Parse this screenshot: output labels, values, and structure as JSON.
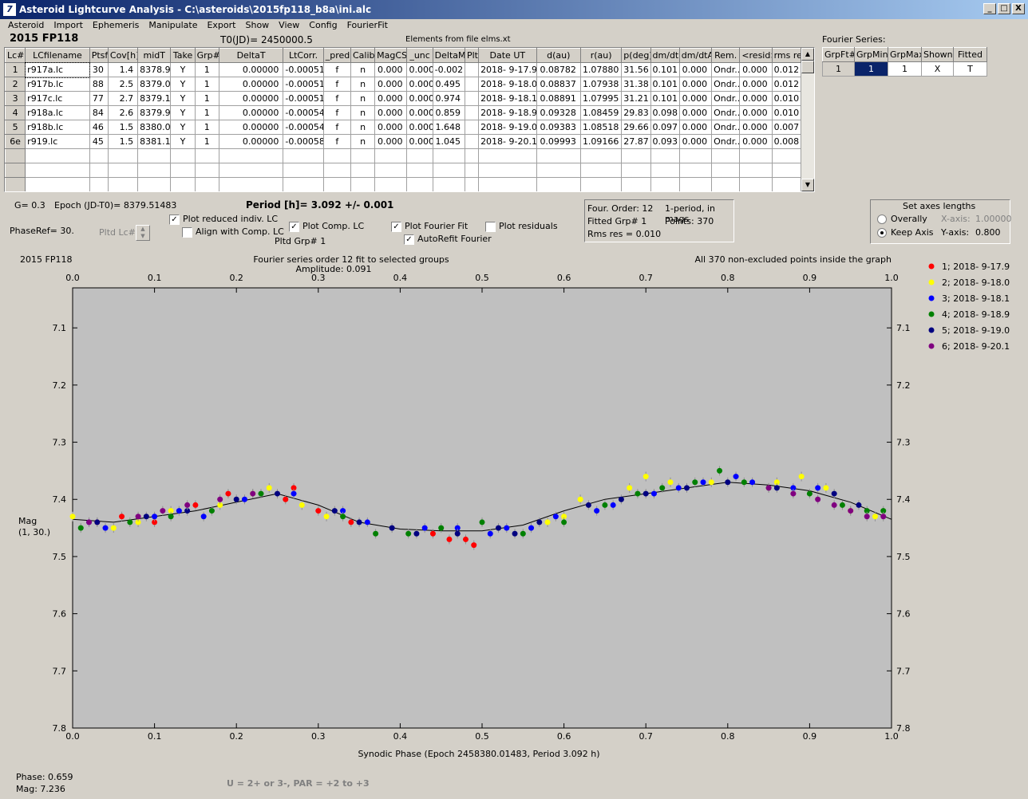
{
  "window": {
    "title": "Asteroid Lightcurve Analysis - C:\\asteroids\\2015fp118_b8a\\ini.alc",
    "icon": "app-icon",
    "minimize": "_",
    "maximize": "□",
    "close": "X"
  },
  "menu": [
    "Asteroid",
    "Import",
    "Ephemeris",
    "Manipulate",
    "Export",
    "Show",
    "View",
    "Config",
    "FourierFit"
  ],
  "header": {
    "asteroid": "2015 FP118",
    "t0": "T0(JD)= 2450000.5",
    "elements": "Elements from file elms.xt"
  },
  "table": {
    "columns": [
      "Lc#",
      "LCfilename",
      "Ptsf",
      "Cov[h]",
      "midT",
      "Take",
      "Grp#",
      "DeltaT",
      "LtCorr.",
      "_pred.",
      "Calib.",
      "MagCS",
      "_unc",
      "DeltaM",
      "Plt",
      "Date UT",
      "d(au)",
      "r(au)",
      "p(deg)",
      "dm/dt",
      "dm/dtA",
      "Rem.",
      "<resid>",
      "rms res"
    ],
    "rows": [
      [
        "1",
        "r917a.lc",
        "30",
        "1.4",
        "8378.9",
        "Y",
        "1",
        "0.00000",
        "-0.00051",
        "f",
        "n",
        "0.000",
        "0.000",
        "-0.002",
        "",
        "2018- 9-17.9",
        "0.08782",
        "1.07880",
        "31.56",
        "0.101",
        "0.000",
        "Ondr...",
        "0.000",
        "0.012"
      ],
      [
        "2",
        "r917b.lc",
        "88",
        "2.5",
        "8379.0",
        "Y",
        "1",
        "0.00000",
        "-0.00051",
        "f",
        "n",
        "0.000",
        "0.000",
        "0.495",
        "",
        "2018- 9-18.0",
        "0.08837",
        "1.07938",
        "31.38",
        "0.101",
        "0.000",
        "Ondr...",
        "0.000",
        "0.012"
      ],
      [
        "3",
        "r917c.lc",
        "77",
        "2.7",
        "8379.1",
        "Y",
        "1",
        "0.00000",
        "-0.00051",
        "f",
        "n",
        "0.000",
        "0.000",
        "0.974",
        "",
        "2018- 9-18.1",
        "0.08891",
        "1.07995",
        "31.21",
        "0.101",
        "0.000",
        "Ondr...",
        "0.000",
        "0.010"
      ],
      [
        "4",
        "r918a.lc",
        "84",
        "2.6",
        "8379.9",
        "Y",
        "1",
        "0.00000",
        "-0.00054",
        "f",
        "n",
        "0.000",
        "0.000",
        "0.859",
        "",
        "2018- 9-18.9",
        "0.09328",
        "1.08459",
        "29.83",
        "0.098",
        "0.000",
        "Ondr...",
        "0.000",
        "0.010"
      ],
      [
        "5",
        "r918b.lc",
        "46",
        "1.5",
        "8380.0",
        "Y",
        "1",
        "0.00000",
        "-0.00054",
        "f",
        "n",
        "0.000",
        "0.000",
        "1.648",
        "",
        "2018- 9-19.0",
        "0.09383",
        "1.08518",
        "29.66",
        "0.097",
        "0.000",
        "Ondr...",
        "0.000",
        "0.007"
      ],
      [
        "6e",
        "r919.lc",
        "45",
        "1.5",
        "8381.1",
        "Y",
        "1",
        "0.00000",
        "-0.00058",
        "f",
        "n",
        "0.000",
        "0.000",
        "1.045",
        "",
        "2018- 9-20.1",
        "0.09993",
        "1.09166",
        "27.87",
        "0.093",
        "0.000",
        "Ondr...",
        "0.000",
        "0.008"
      ]
    ]
  },
  "fourier": {
    "label": "Fourier Series:",
    "columns": [
      "GrpFt#",
      "GrpMin",
      "GrpMax",
      "Shown",
      "Fitted"
    ],
    "row": [
      "1",
      "1",
      "1",
      "X",
      "T"
    ]
  },
  "controls": {
    "g": "G= 0.3",
    "epoch": "Epoch (JD-T0)= 8379.51483",
    "period": "Period [h]= 3.092 +/- 0.001",
    "phaseref": "PhaseRef= 30.",
    "pltdlc": "Pltd Lc#:",
    "plot_reduced": "Plot reduced indiv. LC",
    "align_comp": "Align with Comp. LC",
    "plot_comp": "Plot Comp. LC",
    "pltd_grp": "Pltd Grp#  1",
    "plot_fourier": "Plot Fourier Fit",
    "autorefit": "AutoRefit Fourier",
    "plot_residuals": "Plot residuals"
  },
  "info": {
    "order": "Four. Order: 12",
    "period_mode": "1-period, in mags",
    "fitted": "Fitted Grp# 1",
    "points": "Points: 370",
    "rms": "Rms res      = 0.010"
  },
  "axes_box": {
    "title": "Set axes lengths",
    "overally": "Overally",
    "keep": "Keep Axis",
    "xaxis_label": "X-axis:",
    "xaxis_val": "1.00000",
    "yaxis_label": "Y-axis:",
    "yaxis_val": "0.800"
  },
  "plot_labels": {
    "name": "2015 FP118",
    "title1": "Fourier series order 12 fit to selected groups",
    "title2": "Amplitude: 0.091",
    "note": "All 370 non-excluded points inside the graph",
    "ylabel1": "Mag",
    "ylabel2": "(1, 30.)",
    "xlabel": "Synodic Phase (Epoch 2458380.01483, Period 3.092 h)"
  },
  "status": {
    "phase": "Phase:  0.659",
    "mag": "Mag:    7.236",
    "hint": "U = 2+ or 3-, PAR = +2 to +3"
  },
  "chart_data": {
    "type": "scatter",
    "xlim": [
      0,
      1
    ],
    "ylim": [
      7.8,
      7.03
    ],
    "y_inverted": true,
    "xticks": [
      "0.0",
      "0.1",
      "0.2",
      "0.3",
      "0.4",
      "0.5",
      "0.6",
      "0.7",
      "0.8",
      "0.9",
      "1.0"
    ],
    "yticks": [
      "7.1",
      "7.2",
      "7.3",
      "7.4",
      "7.5",
      "7.6",
      "7.7",
      "7.8"
    ],
    "fit_curve": {
      "x": [
        0,
        0.05,
        0.1,
        0.15,
        0.2,
        0.25,
        0.3,
        0.35,
        0.4,
        0.45,
        0.5,
        0.55,
        0.6,
        0.65,
        0.7,
        0.75,
        0.8,
        0.85,
        0.9,
        0.95,
        1.0
      ],
      "y": [
        7.435,
        7.44,
        7.43,
        7.42,
        7.405,
        7.39,
        7.41,
        7.44,
        7.452,
        7.455,
        7.455,
        7.445,
        7.42,
        7.4,
        7.39,
        7.38,
        7.37,
        7.375,
        7.385,
        7.405,
        7.435
      ]
    },
    "series": [
      {
        "name": "1; 2018- 9-17.9",
        "color": "#ff0000",
        "x": [
          0.03,
          0.06,
          0.1,
          0.15,
          0.19,
          0.26,
          0.27,
          0.3,
          0.34,
          0.44,
          0.46,
          0.48,
          0.49
        ],
        "y": [
          7.44,
          7.43,
          7.44,
          7.41,
          7.39,
          7.4,
          7.38,
          7.42,
          7.44,
          7.46,
          7.47,
          7.47,
          7.48
        ]
      },
      {
        "name": "2; 2018- 9-18.0",
        "color": "#ffff00",
        "x": [
          0.0,
          0.05,
          0.08,
          0.12,
          0.18,
          0.22,
          0.24,
          0.28,
          0.31,
          0.58,
          0.6,
          0.62,
          0.68,
          0.7,
          0.73,
          0.78,
          0.86,
          0.89,
          0.92,
          0.95,
          0.98
        ],
        "y": [
          7.43,
          7.45,
          7.44,
          7.42,
          7.41,
          7.39,
          7.38,
          7.41,
          7.43,
          7.44,
          7.43,
          7.4,
          7.38,
          7.36,
          7.37,
          7.37,
          7.37,
          7.36,
          7.38,
          7.42,
          7.43
        ]
      },
      {
        "name": "3; 2018- 9-18.1",
        "color": "#0000ff",
        "x": [
          0.02,
          0.04,
          0.1,
          0.13,
          0.16,
          0.21,
          0.27,
          0.33,
          0.36,
          0.43,
          0.47,
          0.51,
          0.53,
          0.56,
          0.59,
          0.64,
          0.66,
          0.71,
          0.74,
          0.77,
          0.81,
          0.83,
          0.88,
          0.91
        ],
        "y": [
          7.44,
          7.45,
          7.43,
          7.42,
          7.43,
          7.4,
          7.39,
          7.42,
          7.44,
          7.45,
          7.45,
          7.46,
          7.45,
          7.45,
          7.43,
          7.42,
          7.41,
          7.39,
          7.38,
          7.37,
          7.36,
          7.37,
          7.38,
          7.38
        ]
      },
      {
        "name": "4; 2018- 9-18.9",
        "color": "#008000",
        "x": [
          0.01,
          0.07,
          0.12,
          0.17,
          0.23,
          0.33,
          0.37,
          0.41,
          0.45,
          0.5,
          0.55,
          0.6,
          0.65,
          0.69,
          0.72,
          0.76,
          0.79,
          0.82,
          0.85,
          0.9,
          0.94,
          0.97,
          0.99
        ],
        "y": [
          7.45,
          7.44,
          7.43,
          7.42,
          7.39,
          7.43,
          7.46,
          7.46,
          7.45,
          7.44,
          7.46,
          7.44,
          7.41,
          7.39,
          7.38,
          7.37,
          7.35,
          7.37,
          7.38,
          7.39,
          7.41,
          7.42,
          7.42
        ]
      },
      {
        "name": "5; 2018- 9-19.0",
        "color": "#000080",
        "x": [
          0.03,
          0.09,
          0.14,
          0.2,
          0.25,
          0.32,
          0.35,
          0.39,
          0.42,
          0.47,
          0.52,
          0.54,
          0.57,
          0.63,
          0.67,
          0.7,
          0.75,
          0.8,
          0.86,
          0.93,
          0.96
        ],
        "y": [
          7.44,
          7.43,
          7.42,
          7.4,
          7.39,
          7.42,
          7.44,
          7.45,
          7.46,
          7.46,
          7.45,
          7.46,
          7.44,
          7.41,
          7.4,
          7.39,
          7.38,
          7.37,
          7.38,
          7.39,
          7.41
        ]
      },
      {
        "name": "6; 2018- 9-20.1",
        "color": "#800080",
        "x": [
          0.02,
          0.08,
          0.11,
          0.14,
          0.18,
          0.22,
          0.85,
          0.88,
          0.91,
          0.93,
          0.95,
          0.97,
          0.99
        ],
        "y": [
          7.44,
          7.43,
          7.42,
          7.41,
          7.4,
          7.39,
          7.38,
          7.39,
          7.4,
          7.41,
          7.42,
          7.43,
          7.43
        ]
      }
    ]
  }
}
